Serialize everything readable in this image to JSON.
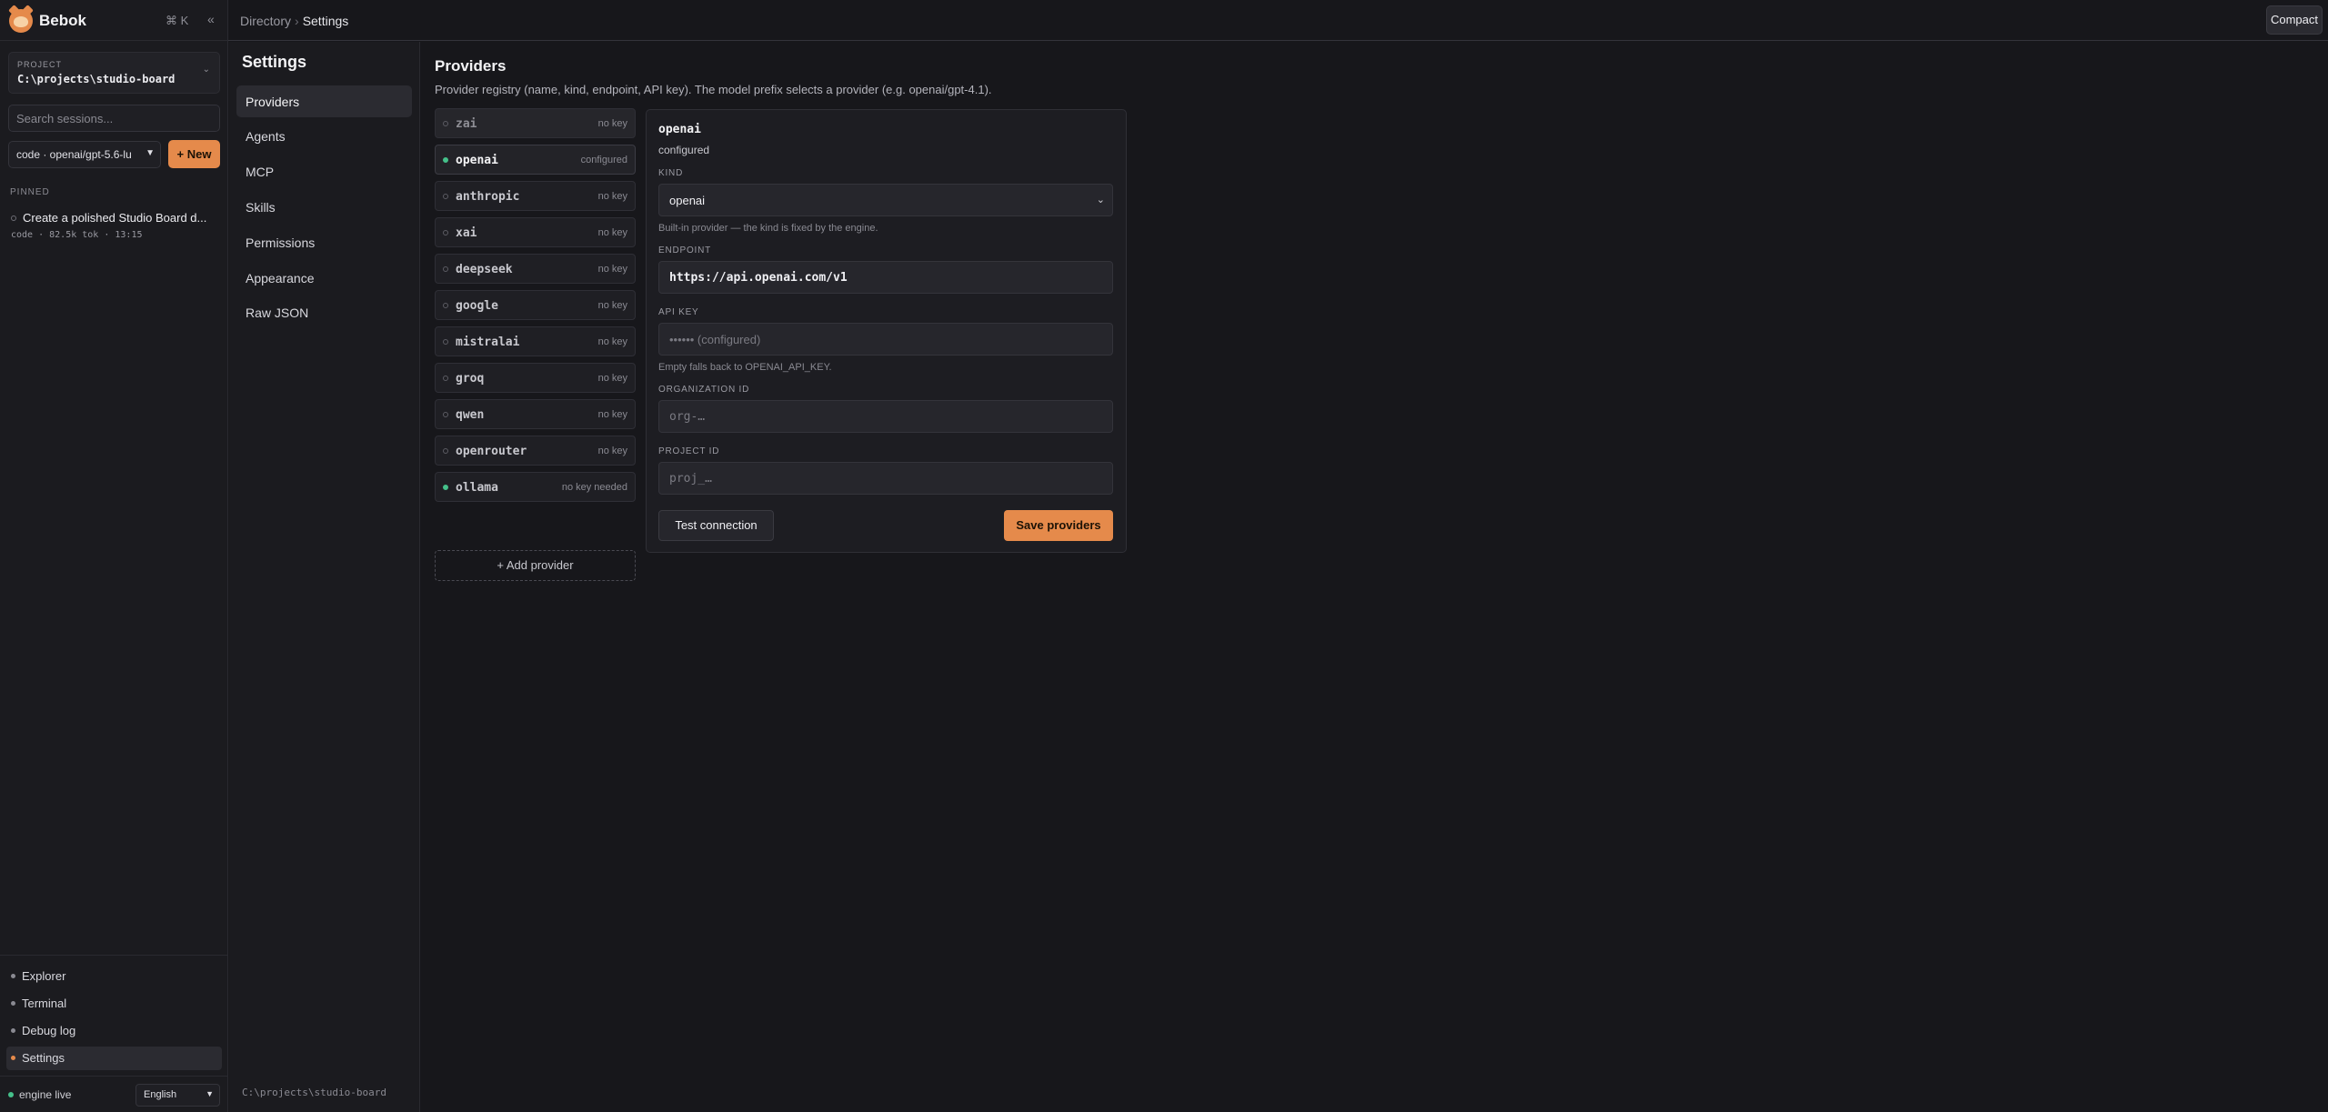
{
  "brand": {
    "name": "Bebok",
    "shortcut": "⌘ K",
    "collapse_icon": "«"
  },
  "project": {
    "caption": "PROJECT",
    "path": "C:\\projects\\studio-board",
    "chevron": "⌄"
  },
  "sessions": {
    "search_placeholder": "Search sessions...",
    "model_value": "code · openai/gpt-5.6-lu",
    "new_label": "+ New",
    "pinned_caption": "PINNED",
    "items": [
      {
        "title": "Create a polished Studio Board d...",
        "meta": "code · 82.5k tok · 13:15"
      }
    ]
  },
  "bottom_nav": {
    "items": [
      {
        "label": "Explorer"
      },
      {
        "label": "Terminal"
      },
      {
        "label": "Debug log"
      },
      {
        "label": "Settings"
      }
    ],
    "active": "Settings"
  },
  "status": {
    "engine": "engine live",
    "language": "English"
  },
  "topbar": {
    "breadcrumb": [
      "Directory",
      "Settings"
    ],
    "separator": "›",
    "compact_label": "Compact"
  },
  "settings": {
    "title": "Settings",
    "nav": [
      {
        "label": "Providers"
      },
      {
        "label": "Agents"
      },
      {
        "label": "MCP"
      },
      {
        "label": "Skills"
      },
      {
        "label": "Permissions"
      },
      {
        "label": "Appearance"
      },
      {
        "label": "Raw JSON"
      }
    ],
    "active": "Providers",
    "footer_path": "C:\\projects\\studio-board"
  },
  "providers": {
    "heading": "Providers",
    "description": "Provider registry (name, kind, endpoint, API key). The model prefix selects a provider (e.g. openai/gpt-4.1).",
    "list": [
      {
        "name": "zai",
        "status": "no key",
        "connected": false
      },
      {
        "name": "openai",
        "status": "configured",
        "connected": true
      },
      {
        "name": "anthropic",
        "status": "no key",
        "connected": false
      },
      {
        "name": "xai",
        "status": "no key",
        "connected": false
      },
      {
        "name": "deepseek",
        "status": "no key",
        "connected": false
      },
      {
        "name": "google",
        "status": "no key",
        "connected": false
      },
      {
        "name": "mistralai",
        "status": "no key",
        "connected": false
      },
      {
        "name": "groq",
        "status": "no key",
        "connected": false
      },
      {
        "name": "qwen",
        "status": "no key",
        "connected": false
      },
      {
        "name": "openrouter",
        "status": "no key",
        "connected": false
      },
      {
        "name": "ollama",
        "status": "no key needed",
        "connected": true
      }
    ],
    "add_label": "+ Add provider",
    "detail": {
      "name": "openai",
      "status": "configured",
      "kind_label": "KIND",
      "kind_value": "openai",
      "kind_help": "Built-in provider — the kind is fixed by the engine.",
      "endpoint_label": "ENDPOINT",
      "endpoint_value": "https://api.openai.com/v1",
      "apikey_label": "API KEY",
      "apikey_placeholder": "•••••• (configured)",
      "apikey_help": "Empty falls back to OPENAI_API_KEY.",
      "org_label": "ORGANIZATION ID",
      "org_placeholder": "org-…",
      "project_label": "PROJECT ID",
      "project_placeholder": "proj_…",
      "test_label": "Test connection",
      "save_label": "Save providers"
    }
  },
  "colors": {
    "accent": "#e58a4b",
    "live_green": "#45c08a",
    "background": "#17171b"
  }
}
